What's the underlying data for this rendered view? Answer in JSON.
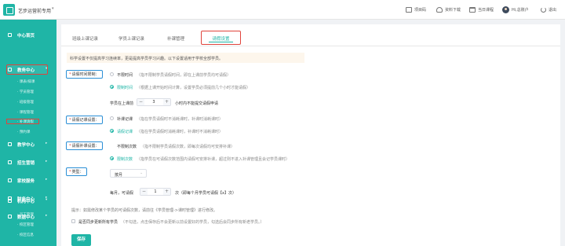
{
  "header": {
    "brand_name": "艺步运营前专用",
    "brand_caret": "▾",
    "actions": [
      {
        "label": "项目码",
        "icon": "qr-code-icon"
      },
      {
        "label": "资料下载",
        "icon": "cloud-download-icon"
      },
      {
        "label": "当日课程",
        "icon": "calendar-icon"
      },
      {
        "label": "Hi,总账户",
        "icon": "avatar"
      },
      {
        "label": "退出",
        "icon": "power-icon"
      }
    ]
  },
  "sidebar": {
    "groups": [
      {
        "label": "中心首页",
        "icon": "grid-icon",
        "caret": ""
      },
      {
        "label": "教务中心",
        "icon": "grid-icon",
        "caret": "▾"
      },
      {
        "label": "教学中心",
        "icon": "book-icon",
        "caret": "▸"
      },
      {
        "label": "招生营销",
        "icon": "megaphone-icon",
        "caret": "▸"
      },
      {
        "label": "家校服务",
        "icon": "heart-icon",
        "caret": "▸"
      },
      {
        "label": "财务中心",
        "icon": "wallet-icon",
        "caret": "▸"
      },
      {
        "label": "数据中心",
        "icon": "chart-icon",
        "caret": "▸"
      },
      {
        "label": "机构中心",
        "icon": "building-icon",
        "caret": "▾"
      }
    ],
    "education_items": [
      "· 课表/排课",
      "· 学员管理",
      "· 班级管理",
      "· 课程管理",
      "· 补课请假",
      "· 预约课"
    ],
    "org_items": [
      "· 员工管理",
      "· 校区管理",
      "· 校区信息"
    ]
  },
  "tabs": {
    "items": [
      "班级上课记录",
      "学员上课记录",
      "补课管理"
    ],
    "active": "请假设置"
  },
  "notice": "科学设置不仅提高学习连续率，更是提高学员学习兴趣。以下设置适用于学校全部学员。",
  "form": {
    "leave_limit": {
      "label": "请假时间限制：",
      "option1_name": "不限时间",
      "option1_desc": "（指不限制学员请假时间，即在上课前学员均可请假）",
      "option2_name": "限制时间",
      "option2_desc": "（根据上课开始时间计算，设置学员必须提前几个小时才能请假）",
      "before_label": "学员在上课前",
      "hours_value": "3",
      "after_label": "小时内不能提交请假申请"
    },
    "leave_record": {
      "label": "请假记课设置：",
      "option1_name": "补课记课",
      "option1_desc": "（指在学员请假时不消耗课时，补课时消耗课时）",
      "option2_name": "请假记课",
      "option2_desc": "（指在学员请假时消耗课时，补课时不消耗课时）"
    },
    "makeup_limit": {
      "label": "请假补课设置：",
      "option1_name": "不限制次数",
      "option1_desc": "（指不限制学员请假次数，即每次请假均可安排补课）",
      "option2_name": "限制次数",
      "option2_desc": "（指学员在可请假次数范围内请假可安排补课，超过则不进入补课管理且会记学员课时）"
    },
    "type": {
      "label": "类型：",
      "selected": "按月",
      "chevron": "⌄"
    },
    "monthly": {
      "before_label": "每月，可请假",
      "value": "1",
      "after_label": "次（即每个月学员可请假【x】次）"
    },
    "tip": "提示：如需修改某个学员的可请假次数，请前往《学员管理->课时管理》进行修改。",
    "sync_label": "是否同步更新所有学员",
    "sync_desc": "（不勾选，点击保存后不会更新以前设置好的学员，勾选后会同步所有新老学员。）",
    "save_label": "保存"
  },
  "stepper_minus": "−",
  "stepper_plus": "+",
  "colors": {
    "accent": "#1fb5a6",
    "highlight": "#e0443c",
    "label_border": "#2b8fd6"
  }
}
